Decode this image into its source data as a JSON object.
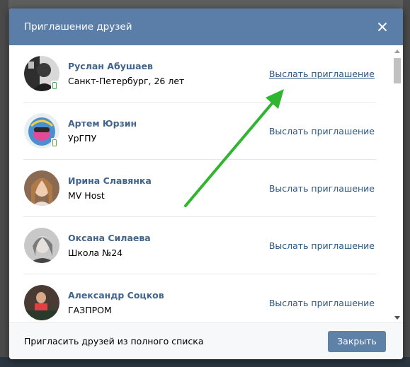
{
  "modal": {
    "title": "Приглашение друзей",
    "footer_link": "Пригласить друзей из полного списка",
    "close_button": "Закрыть"
  },
  "friends": [
    {
      "name": "Руслан Абушаев",
      "sub": "Санкт-Петербург, 26 лет",
      "action": "Выслать приглашение",
      "mobile": true,
      "avatar_color": "#2b2b2b"
    },
    {
      "name": "Артем Юрзин",
      "sub": "УрГПУ",
      "action": "Выслать приглашение",
      "mobile": true,
      "avatar_color": "#5aa0d8"
    },
    {
      "name": "Ирина Славянка",
      "sub": "MV Host",
      "action": "Выслать приглашение",
      "mobile": false,
      "avatar_color": "#b08a6a"
    },
    {
      "name": "Оксана Силаева",
      "sub": "Школа №24",
      "action": "Выслать приглашение",
      "mobile": false,
      "avatar_color": "#9a9a9a"
    },
    {
      "name": "Александр Соцков",
      "sub": "ГАЗПРОМ",
      "action": "Выслать приглашение",
      "mobile": false,
      "avatar_color": "#6a5048"
    }
  ],
  "colors": {
    "header": "#5b7ea8",
    "link": "#2a5885",
    "name": "#42648b",
    "button": "#5e81a8",
    "annotation_arrow": "#2fb52f"
  }
}
